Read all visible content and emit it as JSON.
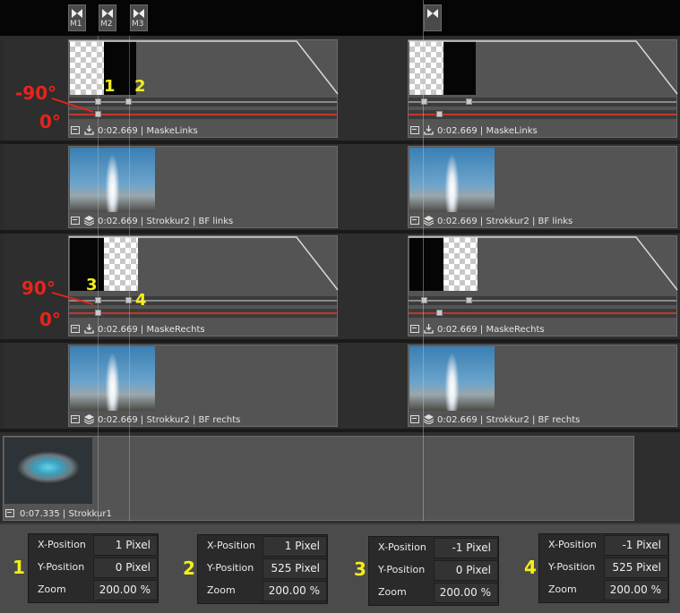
{
  "markers": [
    {
      "label": "M1"
    },
    {
      "label": "M2"
    },
    {
      "label": "M3"
    },
    {
      "label": ""
    }
  ],
  "tracks": {
    "mask_left": {
      "clip_a_label": "0:02.669  |  MaskeLinks",
      "clip_b_label": "0:02.669  |  MaskeLinks"
    },
    "bf_left": {
      "clip_a_label": "0:02.669  |  Strokkur2  |  BF links",
      "clip_b_label": "0:02.669  |  Strokkur2  |  BF links"
    },
    "mask_right": {
      "clip_a_label": "0:02.669  |  MaskeRechts",
      "clip_b_label": "0:02.669  |  MaskeRechts"
    },
    "bf_right": {
      "clip_a_label": "0:02.669  |  Strokkur2  |  BF rechts",
      "clip_b_label": "0:02.669  |  Strokkur2  |  BF rechts"
    },
    "base": {
      "clip_label": "0:07.335  |  Strokkur1"
    }
  },
  "annotations": {
    "angle_neg90": "-90°",
    "angle_0_a": "0°",
    "angle_90": "90°",
    "angle_0_b": "0°",
    "num1": "1",
    "num2": "2",
    "num3": "3",
    "num4": "4"
  },
  "properties": [
    {
      "index": "1",
      "x_label": "X-Position",
      "x_value": "1 Pixel",
      "y_label": "Y-Position",
      "y_value": "0 Pixel",
      "zoom_label": "Zoom",
      "zoom_value": "200.00 %"
    },
    {
      "index": "2",
      "x_label": "X-Position",
      "x_value": "1 Pixel",
      "y_label": "Y-Position",
      "y_value": "525 Pixel",
      "zoom_label": "Zoom",
      "zoom_value": "200.00 %"
    },
    {
      "index": "3",
      "x_label": "X-Position",
      "x_value": "-1 Pixel",
      "y_label": "Y-Position",
      "y_value": "0 Pixel",
      "zoom_label": "Zoom",
      "zoom_value": "200.00 %"
    },
    {
      "index": "4",
      "x_label": "X-Position",
      "x_value": "-1 Pixel",
      "y_label": "Y-Position",
      "y_value": "525 Pixel",
      "zoom_label": "Zoom",
      "zoom_value": "200.00 %"
    }
  ],
  "colors": {
    "annotation_red": "#e8241a",
    "annotation_yellow": "#f4ee1a",
    "keyframe_line_red": "#c0392b"
  }
}
